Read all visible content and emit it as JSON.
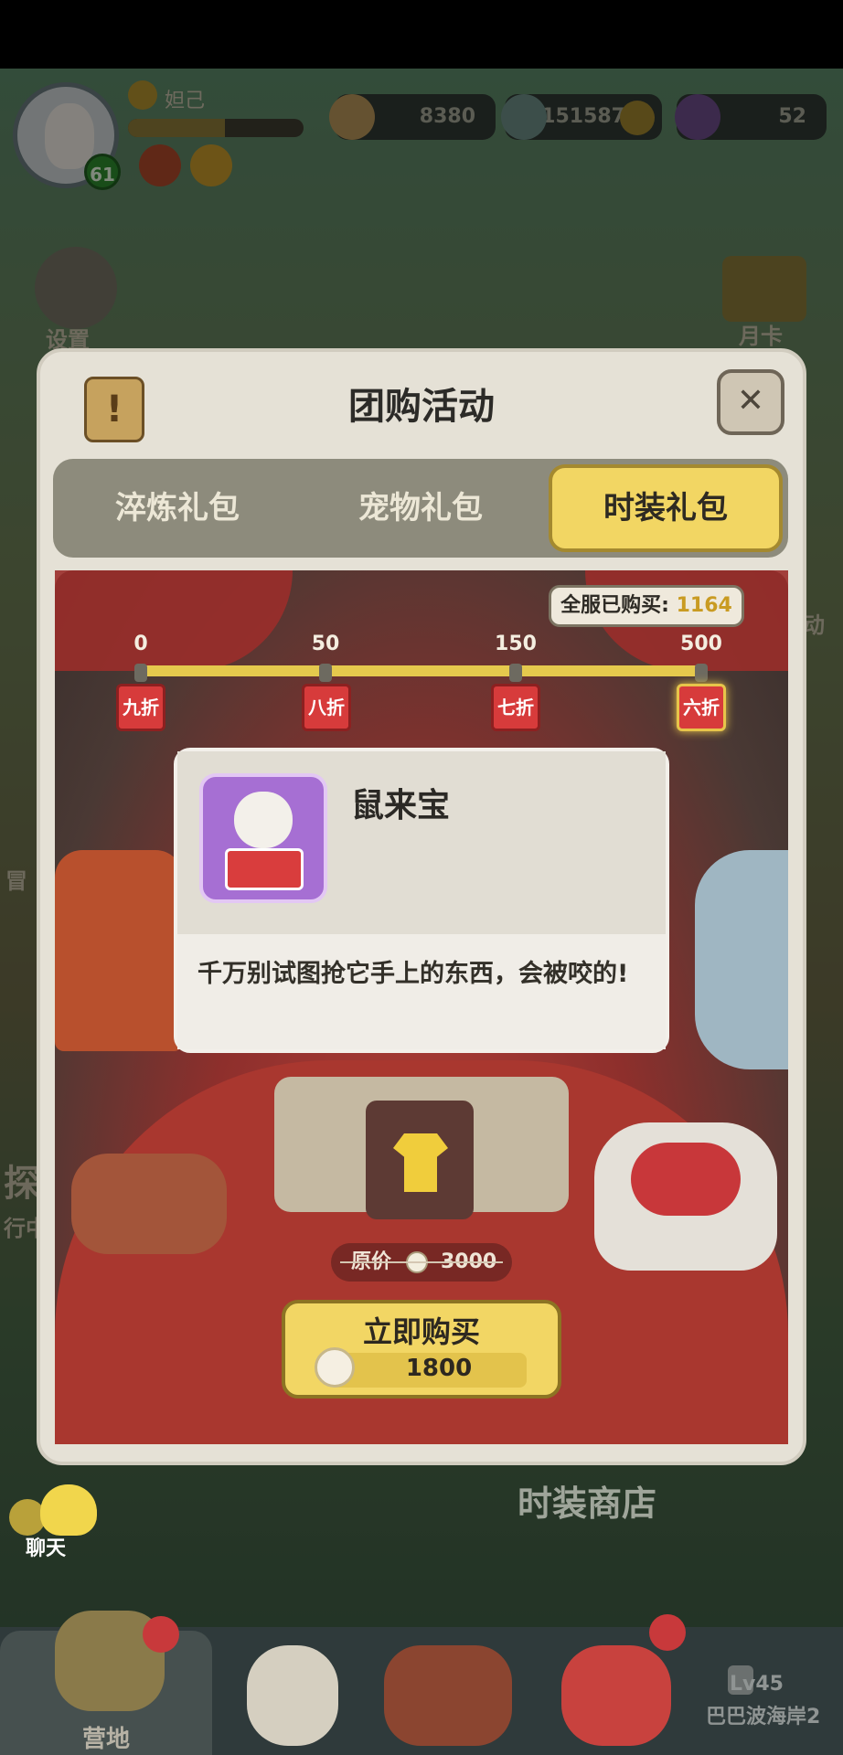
{
  "hud": {
    "player_name": "妲己",
    "level": "61",
    "exp_fraction": 0.55,
    "resources": [
      {
        "name": "pearl",
        "value": "8380",
        "icon": "pearl-icon"
      },
      {
        "name": "shell",
        "value": "151587",
        "icon": "shell-icon"
      },
      {
        "name": "gem",
        "value": "52",
        "icon": "gem-icon"
      }
    ],
    "add_icon": "plus-icon"
  },
  "side": {
    "settings_label": "设置",
    "monthly_card_label": "月卡",
    "explore_label": "探",
    "running_label": "行中",
    "adventure_label": "冒",
    "activity_label": "动"
  },
  "dialog": {
    "title": "团购活动",
    "close_icon": "close-icon",
    "tabs": [
      {
        "label": "淬炼礼包",
        "active": false
      },
      {
        "label": "宠物礼包",
        "active": false
      },
      {
        "label": "时装礼包",
        "active": true
      }
    ],
    "bought_label": "全服已购买:",
    "bought_count": "1164",
    "milestones": [
      {
        "count": "0",
        "discount": "九折",
        "reached": true
      },
      {
        "count": "50",
        "discount": "八折",
        "reached": true
      },
      {
        "count": "150",
        "discount": "七折",
        "reached": true
      },
      {
        "count": "500",
        "discount": "六折",
        "reached": true
      }
    ],
    "item": {
      "name": "鼠来宝",
      "description": "千万别试图抢它手上的东西，会被咬的!"
    },
    "original_price_label": "原价",
    "original_price": "3000",
    "buy_label": "立即购买",
    "buy_price": "1800"
  },
  "bottom": {
    "shop_label": "时装商店",
    "chat_label": "聊天",
    "camp_label": "营地",
    "locked_level": "Lv45",
    "locked_area": "巴巴波海岸2"
  },
  "colors": {
    "accent_yellow": "#f2d663",
    "tag_red": "#d73b3b",
    "panel_bg": "#e5e1d6",
    "item_icon_bg": "#a66fd3"
  }
}
